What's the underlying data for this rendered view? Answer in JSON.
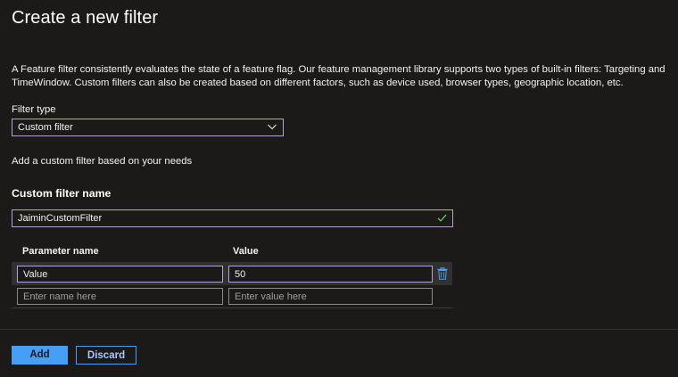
{
  "header": {
    "title": "Create a new filter"
  },
  "description": "A Feature filter consistently evaluates the state of a feature flag. Our feature management library supports two types of built-in filters: Targeting and TimeWindow. Custom filters can also be created based on different factors, such as device used, browser types, geographic location, etc.",
  "filter_type": {
    "label": "Filter type",
    "selected": "Custom filter",
    "icon": "chevron-down-icon"
  },
  "custom_hint": "Add a custom filter based on your needs",
  "custom_filter_name": {
    "label": "Custom filter name",
    "value": "JaiminCustomFilter",
    "icon": "checkmark-icon"
  },
  "parameters": {
    "columns": [
      "Parameter name",
      "Value"
    ],
    "rows": [
      {
        "name": "Value",
        "value": "50"
      }
    ],
    "new_row": {
      "name_placeholder": "Enter name here",
      "value_placeholder": "Enter value here"
    },
    "delete_icon": "trash-icon"
  },
  "footer": {
    "add_label": "Add",
    "discard_label": "Discard"
  },
  "colors": {
    "background": "#1b1a19",
    "accent": "#479ef5",
    "focus_border": "#b5a3d6",
    "selected_row": "#323130"
  }
}
